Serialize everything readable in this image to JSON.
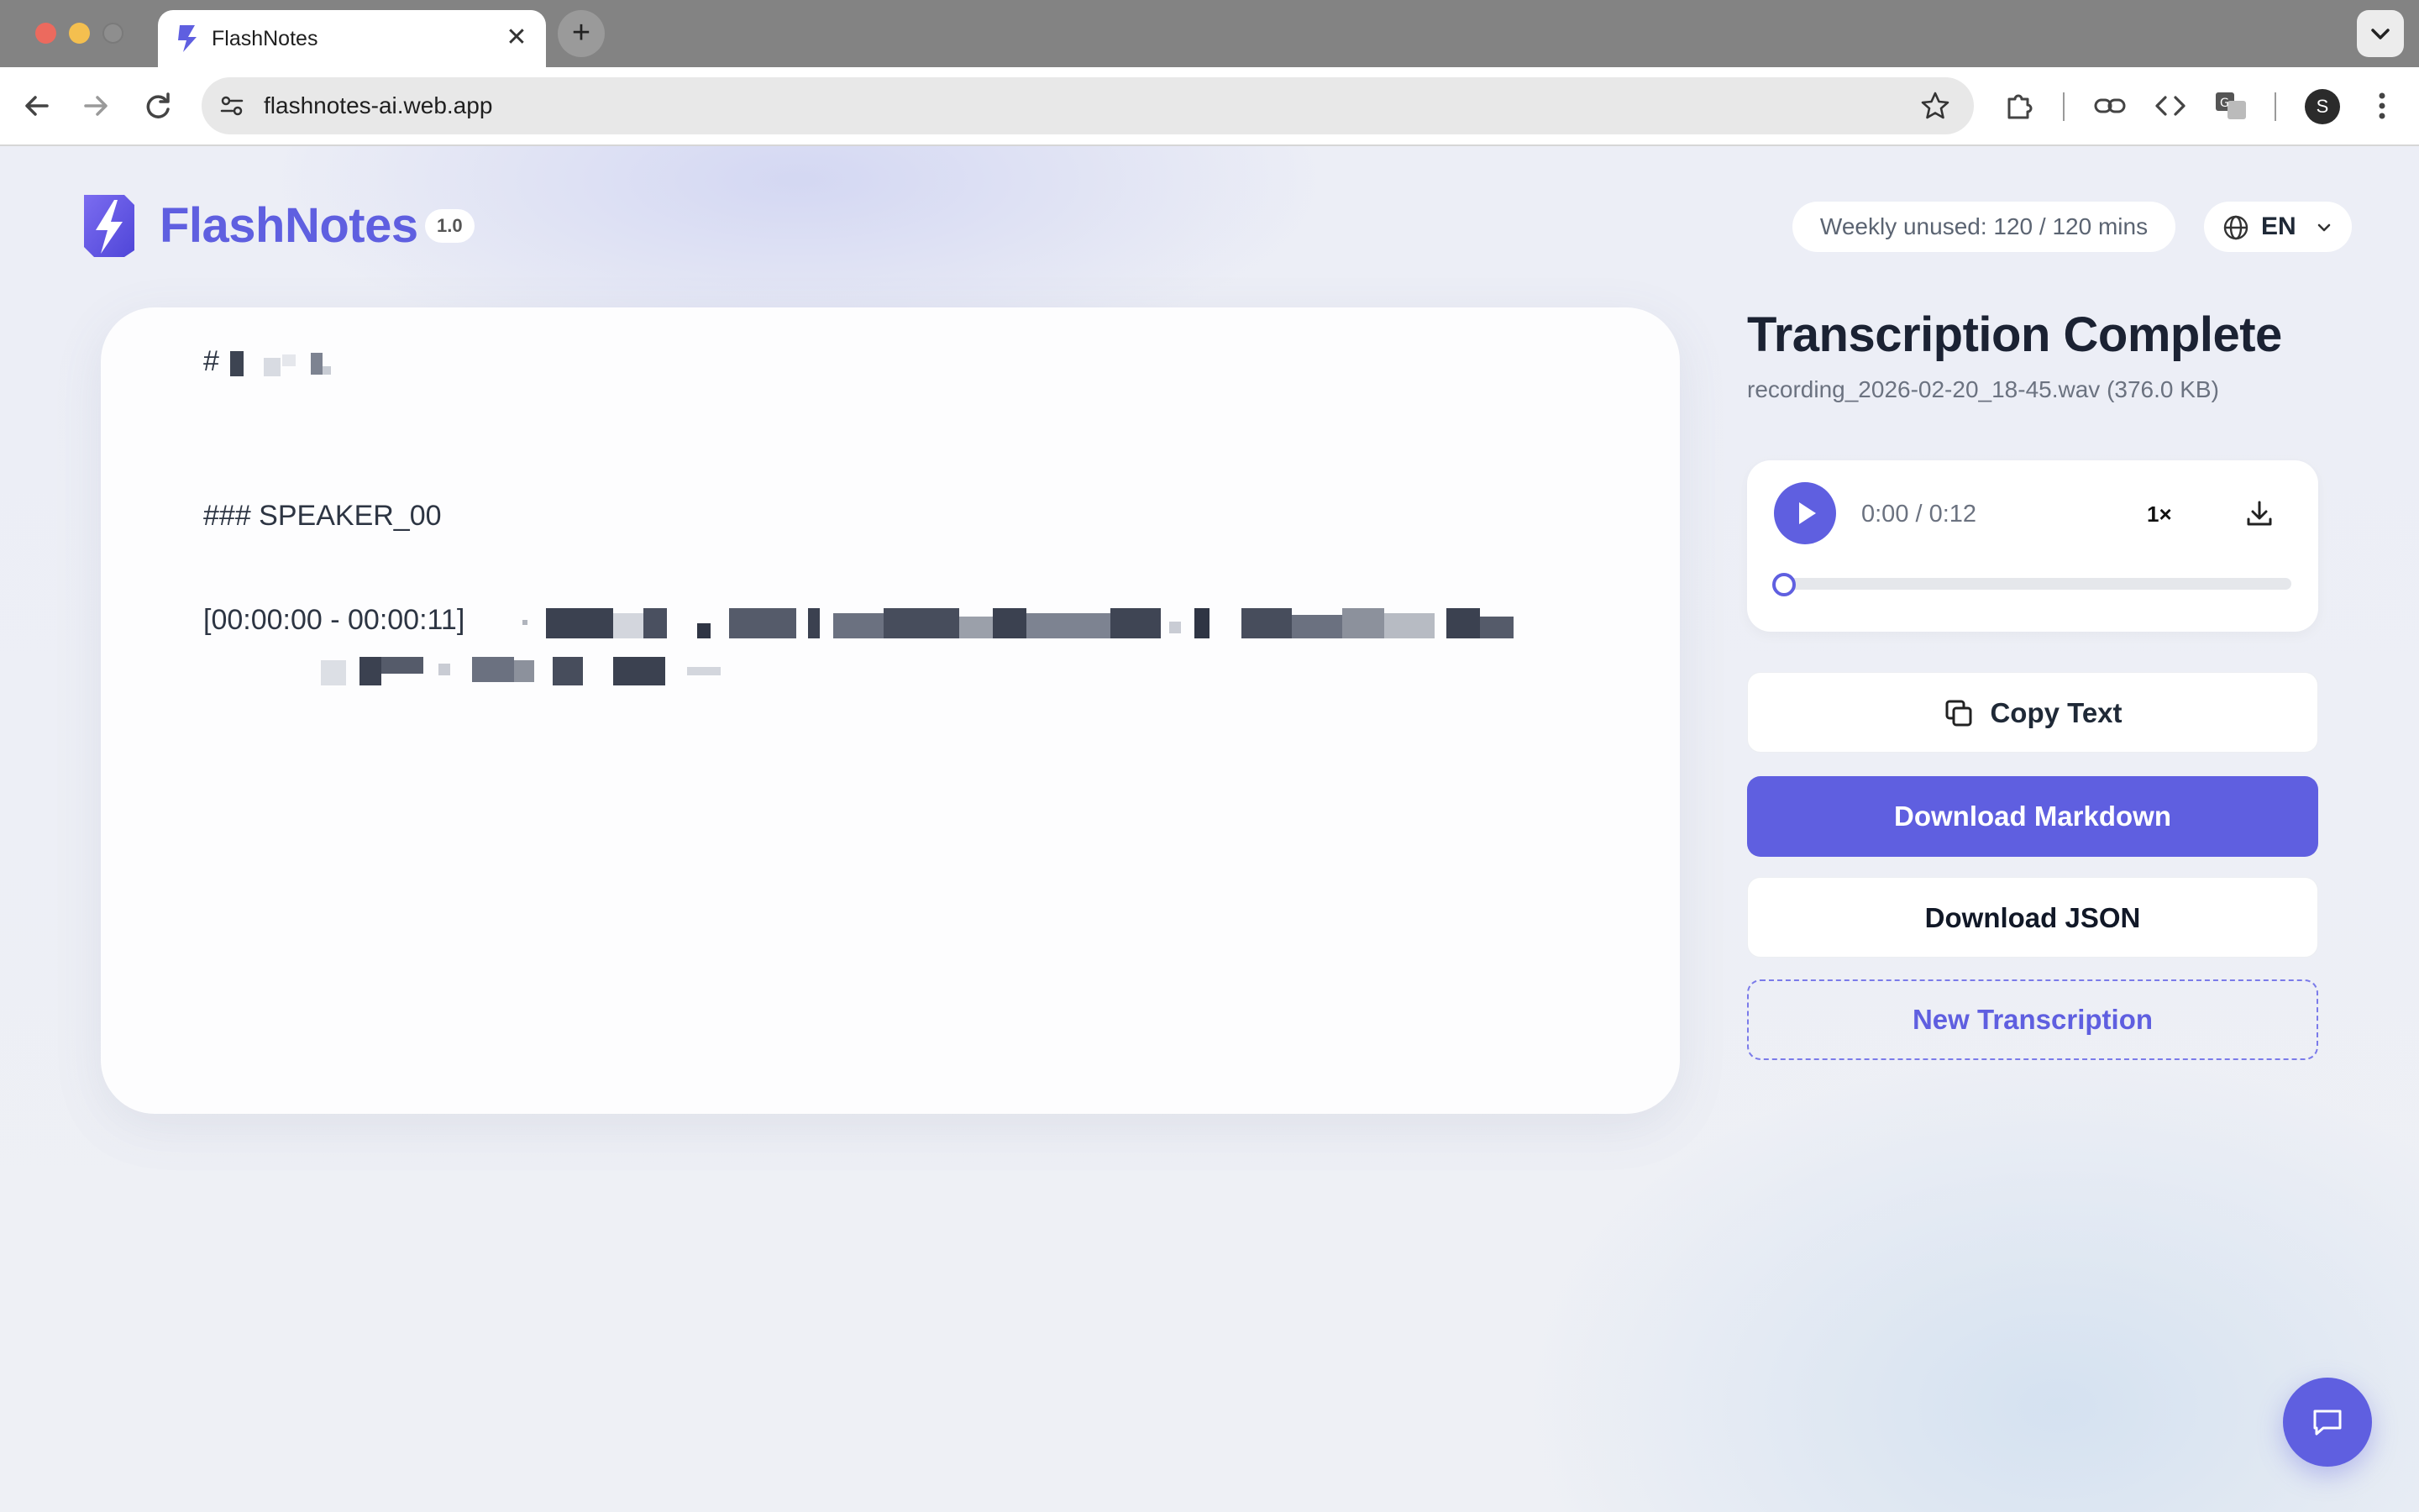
{
  "browser": {
    "tab_title": "FlashNotes",
    "tab_close": "✕",
    "new_tab": "+",
    "url": "flashnotes-ai.web.app",
    "profile_initial": "S"
  },
  "header": {
    "brand": "FlashNotes",
    "version": "1.0",
    "usage": "Weekly unused: 120 / 120 mins",
    "language": "EN"
  },
  "document": {
    "heading_prefix": "#",
    "speaker_heading": "### SPEAKER_00",
    "segment_timestamp": "[00:00:00 - 00:00:11]"
  },
  "sidebar": {
    "title": "Transcription Complete",
    "file_info": "recording_2026-02-20_18-45.wav (376.0 KB)",
    "player": {
      "time": "0:00 / 0:12",
      "speed": "1×",
      "progress": 0
    },
    "buttons": {
      "copy": "Copy Text",
      "download_markdown": "Download Markdown",
      "download_json": "Download JSON",
      "new_transcription": "New Transcription"
    }
  },
  "colors": {
    "accent": "#5f5fe0",
    "text_dark": "#1b2233",
    "muted": "#6b7280"
  }
}
